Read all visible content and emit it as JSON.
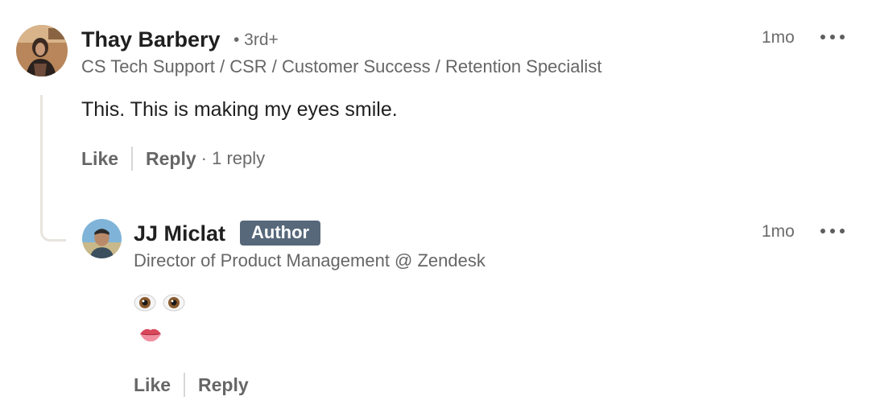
{
  "comment": {
    "author_name": "Thay Barbery",
    "degree": "• 3rd+",
    "headline": "CS Tech Support / CSR / Customer Success / Retention Specialist",
    "time": "1mo",
    "text": "This. This is making my eyes smile.",
    "actions": {
      "like": "Like",
      "reply": "Reply",
      "reply_count": "· 1 reply"
    },
    "avatar_icon": "profile-photo-woman"
  },
  "reply": {
    "author_name": "JJ Miclat",
    "badge": "Author",
    "headline": "Director of Product Management @ Zendesk",
    "time": "1mo",
    "emoji_lines": [
      [
        "eye-icon",
        "eye-icon"
      ],
      [
        "lips-icon"
      ]
    ],
    "actions": {
      "like": "Like",
      "reply": "Reply"
    },
    "avatar_icon": "profile-photo-man"
  },
  "colors": {
    "badge_bg": "#56687a",
    "thread_line": "#e8e4de",
    "secondary_text": "#666666"
  }
}
